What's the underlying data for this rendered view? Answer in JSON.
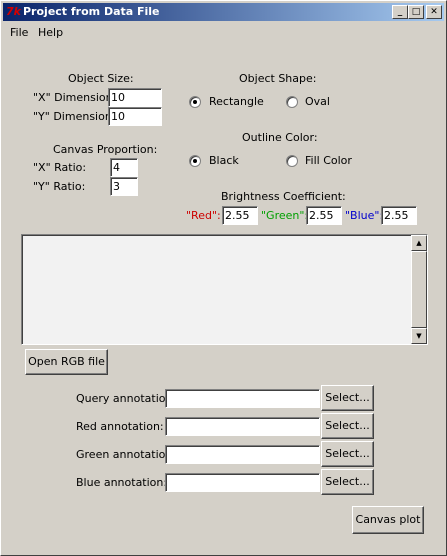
{
  "window": {
    "title": "Project from Data File",
    "icon": "tk-feather-icon"
  },
  "menu": {
    "file": "File",
    "help": "Help"
  },
  "object_size": {
    "heading": "Object Size:",
    "x_label": "\"X\" Dimension:",
    "x_value": "10",
    "y_label": "\"Y\" Dimension:",
    "y_value": "10"
  },
  "object_shape": {
    "heading": "Object Shape:",
    "rectangle": "Rectangle",
    "oval": "Oval",
    "selected": "Rectangle"
  },
  "canvas_proportion": {
    "heading": "Canvas Proportion:",
    "x_label": "\"X\" Ratio:",
    "x_value": "4",
    "y_label": "\"Y\" Ratio:",
    "y_value": "3"
  },
  "outline_color": {
    "heading": "Outline Color:",
    "black": "Black",
    "fill": "Fill Color",
    "selected": "Black"
  },
  "brightness": {
    "heading": "Brightness Coefficient:",
    "red_label": "\"Red\":",
    "red_value": "2.55",
    "green_label": "\"Green\":",
    "green_value": "2.55",
    "blue_label": "\"Blue\":",
    "blue_value": "2.55"
  },
  "colors": {
    "red": "#cc0000",
    "green": "#00a000",
    "blue": "#0000cc",
    "titlebar": "#0a246a",
    "background": "#d4d0c8"
  },
  "buttons": {
    "open_rgb": "Open RGB file",
    "select": "Select...",
    "canvas_plot": "Canvas plot"
  },
  "annotations": {
    "query": "Query annotation:",
    "red": "Red annotation:",
    "green": "Green annotation:",
    "blue": "Blue annotation:"
  }
}
